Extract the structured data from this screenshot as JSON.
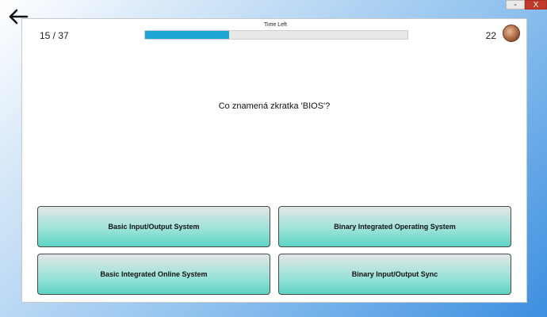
{
  "window": {
    "minimize_label": "-",
    "close_label": "X"
  },
  "header": {
    "counter": "15 / 37",
    "timer_label": "Time Left",
    "timer_progress": 0.32,
    "score": "22",
    "accent_color": "#1ea7d6"
  },
  "question": {
    "text": "Co znamená zkratka 'BIOS'?"
  },
  "answers": [
    {
      "label": "Basic Input/Output System"
    },
    {
      "label": "Binary Integrated Operating System"
    },
    {
      "label": "Basic Integrated Online System"
    },
    {
      "label": "Binary Input/Output Sync"
    }
  ]
}
